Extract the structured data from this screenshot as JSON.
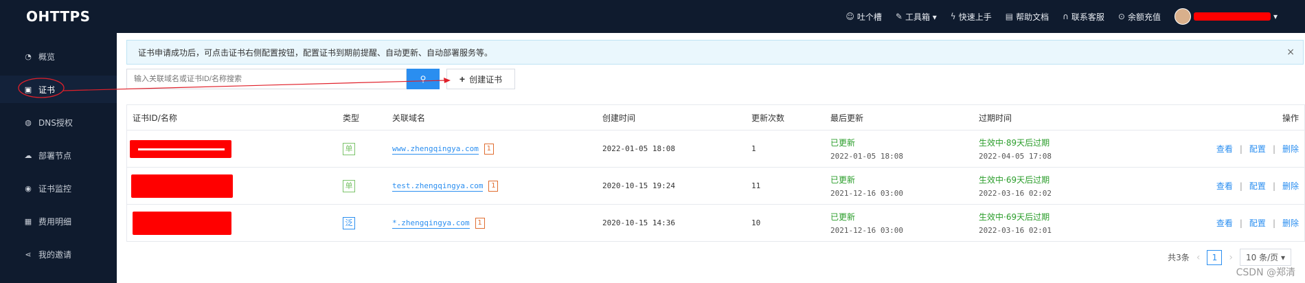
{
  "header": {
    "logo": "OHTTPS",
    "nav": [
      {
        "icon": "smile-icon",
        "glyph": "☺",
        "label": "吐个槽"
      },
      {
        "icon": "wrench-icon",
        "glyph": "🔧",
        "label": "工具箱 ▾"
      },
      {
        "icon": "lightning-icon",
        "glyph": "⚡",
        "label": "快速上手"
      },
      {
        "icon": "doc-icon",
        "glyph": "▤",
        "label": "帮助文档"
      },
      {
        "icon": "headset-icon",
        "glyph": "☊",
        "label": "联系客服"
      },
      {
        "icon": "coin-icon",
        "glyph": "¥",
        "label": "余额充值"
      }
    ],
    "user_caret": "▾"
  },
  "sidebar": {
    "items": [
      {
        "icon": "dashboard-icon",
        "glyph": "◔",
        "label": "概览"
      },
      {
        "icon": "certificate-icon",
        "glyph": "▣",
        "label": "证书"
      },
      {
        "icon": "globe-icon",
        "glyph": "◍",
        "label": "DNS授权"
      },
      {
        "icon": "cloud-icon",
        "glyph": "☁",
        "label": "部署节点"
      },
      {
        "icon": "eye-icon",
        "glyph": "◉",
        "label": "证书监控"
      },
      {
        "icon": "bill-icon",
        "glyph": "▦",
        "label": "费用明细"
      },
      {
        "icon": "share-icon",
        "glyph": "⋖",
        "label": "我的邀请"
      }
    ]
  },
  "alert": {
    "text": "证书申请成功后，可点击证书右侧配置按钮，配置证书到期前提醒、自动更新、自动部署服务等。",
    "close": "×"
  },
  "search": {
    "placeholder": "输入关联域名或证书ID/名称搜索",
    "button_glyph": "⚲"
  },
  "create_button": {
    "glyph": "+",
    "label": "创建证书"
  },
  "table": {
    "headers": {
      "id": "证书ID/名称",
      "type": "类型",
      "domain": "关联域名",
      "created": "创建时间",
      "renewals": "更新次数",
      "last_update": "最后更新",
      "expiry": "过期时间",
      "actions": "操作"
    },
    "rows": [
      {
        "type": "单",
        "type_kind": "single",
        "domain": "www.zhengqingya.com",
        "count": "1",
        "created": "2022-01-05 18:08",
        "renewals": "1",
        "last_status": "已更新",
        "last_time": "2022-01-05 18:08",
        "expiry_status": "生效中·89天后过期",
        "expiry_time": "2022-04-05 17:08"
      },
      {
        "type": "单",
        "type_kind": "single",
        "domain": "test.zhengqingya.com",
        "count": "1",
        "created": "2020-10-15 19:24",
        "renewals": "11",
        "last_status": "已更新",
        "last_time": "2021-12-16 03:00",
        "expiry_status": "生效中·69天后过期",
        "expiry_time": "2022-03-16 02:02"
      },
      {
        "type": "泛",
        "type_kind": "wildcard",
        "domain": "*.zhengqingya.com",
        "count": "1",
        "created": "2020-10-15 14:36",
        "renewals": "10",
        "last_status": "已更新",
        "last_time": "2021-12-16 03:00",
        "expiry_status": "生效中·69天后过期",
        "expiry_time": "2022-03-16 02:01"
      }
    ],
    "actions": {
      "view": "查看",
      "config": "配置",
      "delete": "删除",
      "sep": "|"
    }
  },
  "pager": {
    "total": "共3条",
    "prev": "‹",
    "page": "1",
    "next": "›",
    "page_size": "10 条/页 ▾"
  },
  "watermark": "CSDN @郑清",
  "colors": {
    "header_bg": "#0f1b2e",
    "accent": "#2a8ef0",
    "redaction": "#ff0000",
    "success": "#2a9d2a"
  }
}
